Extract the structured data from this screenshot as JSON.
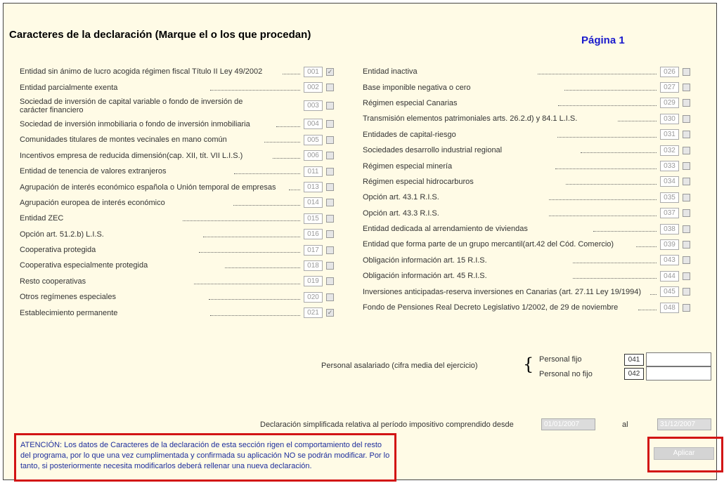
{
  "header": {
    "title": "Caracteres de la declaración (Marque el o los que procedan)",
    "page_label": "Página 1"
  },
  "left_items": [
    {
      "label": "Entidad sin ánimo de lucro acogida régimen fiscal Título II Ley 49/2002",
      "code": "001",
      "checked": true
    },
    {
      "label": "Entidad parcialmente exenta",
      "code": "002",
      "checked": false
    },
    {
      "label": "Sociedad de inversión de capital variable o fondo de inversión de carácter financiero",
      "code": "003",
      "checked": false
    },
    {
      "label": "Sociedad de inversión inmobiliaria o fondo de inversión inmobiliaria",
      "code": "004",
      "checked": false
    },
    {
      "label": "Comunidades titulares de montes vecinales en mano común",
      "code": "005",
      "checked": false
    },
    {
      "label": "Incentivos empresa de reducida dimensión(cap. XII, tít. VII L.I.S.)",
      "code": "006",
      "checked": false
    },
    {
      "label": "Entidad de tenencia de valores extranjeros",
      "code": "011",
      "checked": false
    },
    {
      "label": "Agrupación de interés económico española o Unión temporal de empresas",
      "code": "013",
      "checked": false
    },
    {
      "label": "Agrupación europea de interés económico",
      "code": "014",
      "checked": false
    },
    {
      "label": "Entidad ZEC",
      "code": "015",
      "checked": false
    },
    {
      "label": "Opción art. 51.2.b) L.I.S.",
      "code": "016",
      "checked": false
    },
    {
      "label": "Cooperativa protegida",
      "code": "017",
      "checked": false
    },
    {
      "label": "Cooperativa especialmente protegida",
      "code": "018",
      "checked": false
    },
    {
      "label": "Resto cooperativas",
      "code": "019",
      "checked": false
    },
    {
      "label": "Otros regímenes especiales",
      "code": "020",
      "checked": false
    },
    {
      "label": "Establecimiento permanente",
      "code": "021",
      "checked": true
    }
  ],
  "right_items": [
    {
      "label": "Entidad inactiva",
      "code": "026",
      "checked": false
    },
    {
      "label": "Base imponible negativa o cero",
      "code": "027",
      "checked": false
    },
    {
      "label": "Régimen especial Canarias",
      "code": "029",
      "checked": false
    },
    {
      "label": "Transmisión elementos patrimoniales arts. 26.2.d) y 84.1 L.I.S.",
      "code": "030",
      "checked": false
    },
    {
      "label": "Entidades de capital-riesgo",
      "code": "031",
      "checked": false
    },
    {
      "label": "Sociedades desarrollo industrial regional",
      "code": "032",
      "checked": false
    },
    {
      "label": "Régimen especial minería",
      "code": "033",
      "checked": false
    },
    {
      "label": "Régimen especial hidrocarburos",
      "code": "034",
      "checked": false
    },
    {
      "label": "Opción art. 43.1 R.I.S.",
      "code": "035",
      "checked": false
    },
    {
      "label": "Opción art. 43.3 R.I.S.",
      "code": "037",
      "checked": false
    },
    {
      "label": "Entidad dedicada al arrendamiento de viviendas",
      "code": "038",
      "checked": false
    },
    {
      "label": "Entidad que forma parte de un grupo mercantil(art.42 del Cód. Comercio)",
      "code": "039",
      "checked": false
    },
    {
      "label": "Obligación información art. 15 R.I.S.",
      "code": "043",
      "checked": false
    },
    {
      "label": "Obligación información art. 45 R.I.S.",
      "code": "044",
      "checked": false
    },
    {
      "label": "Inversiones anticipadas-reserva inversiones en Canarias (art. 27.11 Ley 19/1994)",
      "code": "045",
      "checked": false
    },
    {
      "label": "Fondo de Pensiones Real Decreto Legislativo 1/2002, de 29 de noviembre",
      "code": "048",
      "checked": false
    }
  ],
  "personal": {
    "label": "Personal asalariado (cifra media del ejercicio)",
    "brace": "{",
    "fijo_label": "Personal fijo",
    "fijo_code": "041",
    "fijo_value": "",
    "no_fijo_label": "Personal no fijo",
    "no_fijo_code": "042",
    "no_fijo_value": ""
  },
  "simplificada": {
    "label": "Declaración simplificada relativa al período impositivo comprendido desde",
    "from": "01/01/2007",
    "al": "al",
    "to": "31/12/2007"
  },
  "atencion_text": "ATENCIÓN: Los datos de Caracteres de la declaración de esta sección rigen el comportamiento del resto del programa, por lo que una vez cumplimentada y confirmada su aplicación NO se podrán modificar. Por lo tanto, si posteriormente necesita modificarlos deberá rellenar una nueva declaración.",
  "apply_label": "Aplicar",
  "colors": {
    "background": "#fffbe6",
    "page_label": "#1a1acc",
    "highlight": "#d21414",
    "notice_text": "#1d2e9c"
  },
  "icons": {
    "checked": "check-icon",
    "unchecked": "checkbox"
  }
}
